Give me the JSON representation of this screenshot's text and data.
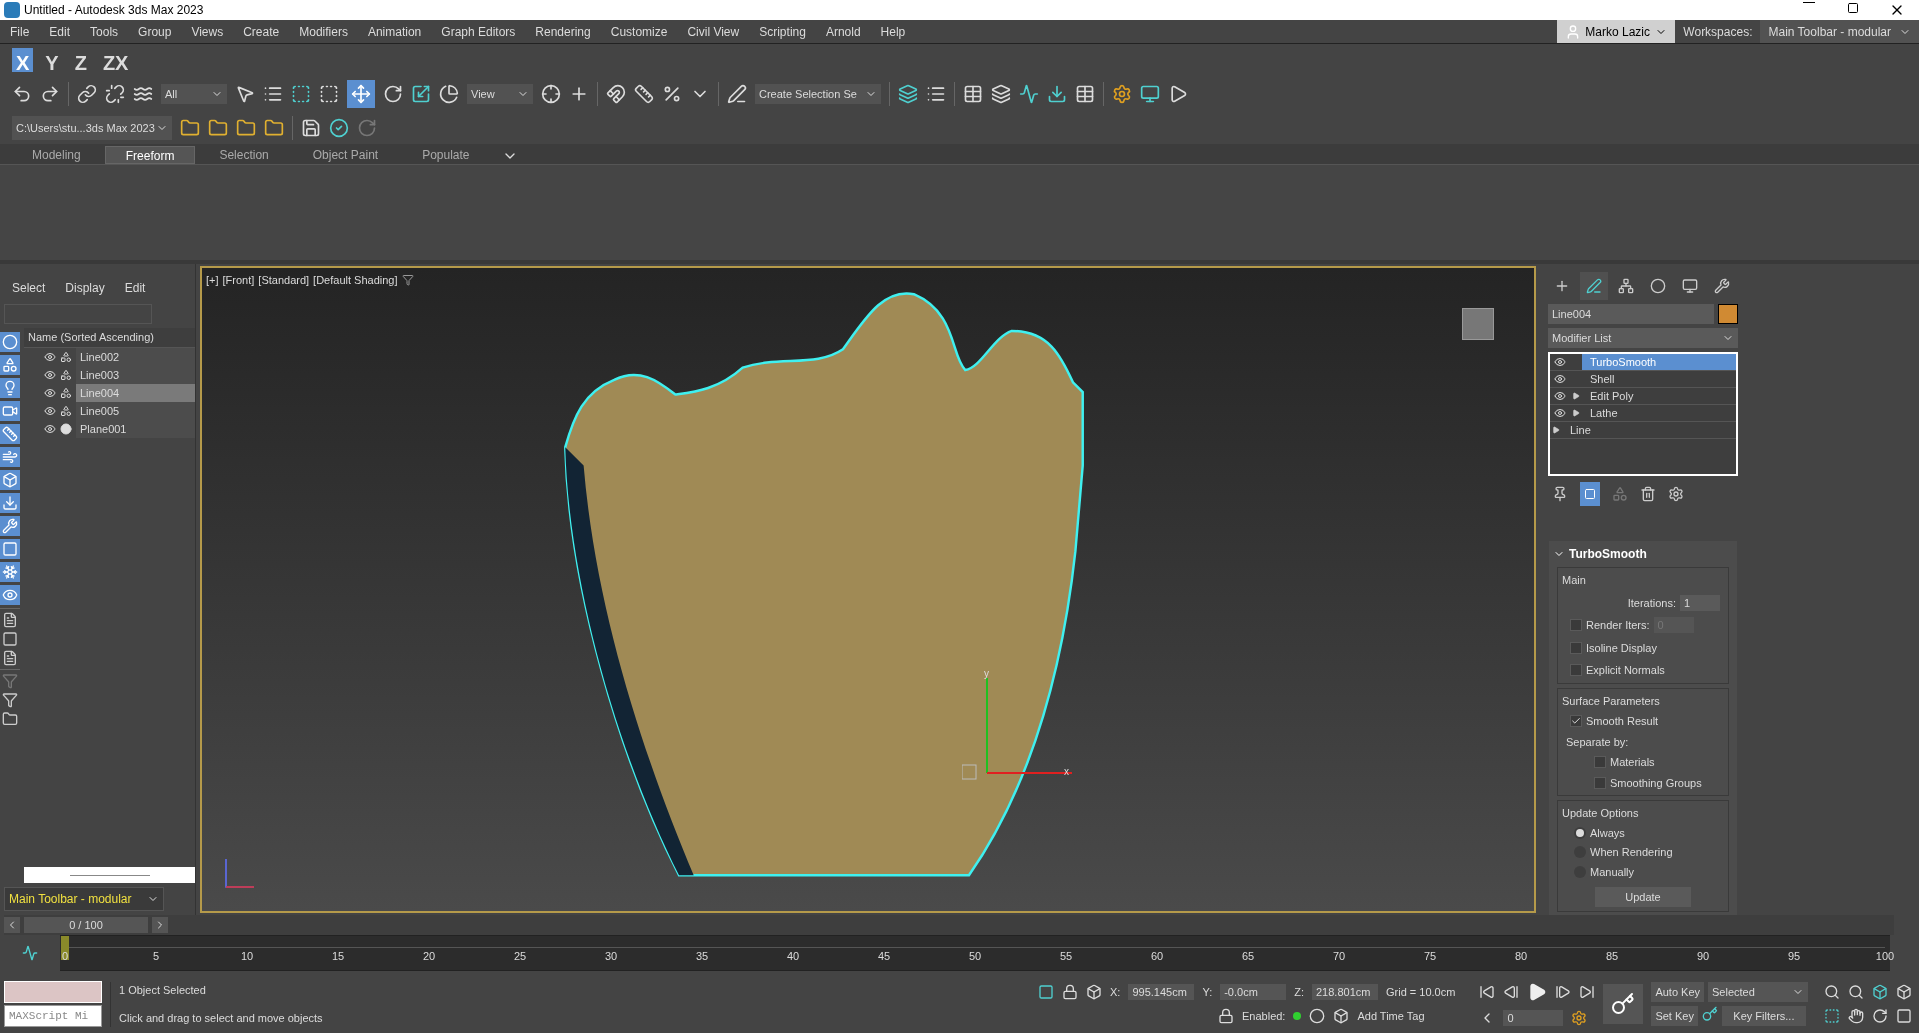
{
  "window": {
    "title": "Untitled - Autodesk 3ds Max 2023"
  },
  "menu": [
    "File",
    "Edit",
    "Tools",
    "Group",
    "Views",
    "Create",
    "Modifiers",
    "Animation",
    "Graph Editors",
    "Rendering",
    "Customize",
    "Civil View",
    "Scripting",
    "Arnold",
    "Help"
  ],
  "user": {
    "name": "Marko Lazic"
  },
  "workspaces": {
    "label": "Workspaces:",
    "value": "Main Toolbar - modular"
  },
  "axis_toolbar": [
    {
      "label": "X",
      "selected": true
    },
    {
      "label": "Y",
      "selected": false
    },
    {
      "label": "Z",
      "selected": false
    },
    {
      "label": "ZX",
      "selected": false
    }
  ],
  "main_toolbar": {
    "selection_filter": "All",
    "reference_coordinate": "View",
    "named_selection": "Create Selection Se"
  },
  "project_path": "C:\\Users\\stu...3ds Max 2023",
  "ribbon_tabs": [
    {
      "label": "Modeling",
      "selected": false
    },
    {
      "label": "Freeform",
      "selected": true
    },
    {
      "label": "Selection",
      "selected": false
    },
    {
      "label": "Object Paint",
      "selected": false
    },
    {
      "label": "Populate",
      "selected": false
    }
  ],
  "scene_explorer": {
    "menu": [
      "Select",
      "Display",
      "Edit"
    ],
    "column": "Name (Sorted Ascending)",
    "items": [
      {
        "name": "Line002",
        "kind": "shape",
        "selected": false
      },
      {
        "name": "Line003",
        "kind": "shape",
        "selected": false
      },
      {
        "name": "Line004",
        "kind": "shape",
        "selected": true
      },
      {
        "name": "Line005",
        "kind": "shape",
        "selected": false
      },
      {
        "name": "Plane001",
        "kind": "geometry",
        "selected": false
      }
    ]
  },
  "workspace_selector": "Main Toolbar - modular",
  "viewport": {
    "labels": [
      "[+]",
      "[Front]",
      "[Standard]",
      "[Default Shading]"
    ],
    "gizmo": {
      "x": "x",
      "y": "y"
    }
  },
  "command_panel": {
    "tabs": [
      {
        "selected": false
      },
      {
        "selected": true
      },
      {
        "selected": false
      },
      {
        "selected": false
      },
      {
        "selected": false
      },
      {
        "selected": false
      }
    ],
    "object_name": "Line004",
    "modifier_list": "Modifier List",
    "stack": [
      {
        "name": "TurboSmooth",
        "kind": "modifier",
        "expandable": false,
        "selected": true
      },
      {
        "name": "Shell",
        "kind": "modifier",
        "expandable": false,
        "selected": false
      },
      {
        "name": "Edit Poly",
        "kind": "modifier",
        "expandable": true,
        "selected": false
      },
      {
        "name": "Lathe",
        "kind": "modifier",
        "expandable": true,
        "selected": false
      },
      {
        "name": "Line",
        "kind": "base",
        "expandable": true,
        "selected": false
      }
    ],
    "rollout": {
      "title": "TurboSmooth",
      "main": {
        "title": "Main",
        "iterations_label": "Iterations:",
        "iterations": "1",
        "render_iters": {
          "label": "Render Iters:",
          "value": "0",
          "checked": false
        },
        "options": [
          {
            "label": "Isoline Display",
            "checked": false
          },
          {
            "label": "Explicit Normals",
            "checked": false
          }
        ]
      },
      "surface": {
        "title": "Surface Parameters",
        "smooth_result": {
          "label": "Smooth Result",
          "checked": true
        },
        "separate_label": "Separate by:",
        "separate": [
          {
            "label": "Materials",
            "checked": false
          },
          {
            "label": "Smoothing Groups",
            "checked": false
          }
        ]
      },
      "update": {
        "title": "Update Options",
        "options": [
          {
            "label": "Always",
            "selected": true
          },
          {
            "label": "When Rendering",
            "selected": false
          },
          {
            "label": "Manually",
            "selected": false
          }
        ],
        "button": "Update"
      }
    }
  },
  "timeline": {
    "slider": {
      "label": "0 / 100"
    },
    "ticks": [
      "0",
      "5",
      "10",
      "15",
      "20",
      "25",
      "30",
      "35",
      "40",
      "45",
      "50",
      "55",
      "60",
      "65",
      "70",
      "75",
      "80",
      "85",
      "90",
      "95",
      "100"
    ]
  },
  "status": {
    "maxscript_placeholder": "MAXScript Mi",
    "selection": "1 Object Selected",
    "prompt": "Click and drag to select and move objects",
    "x_label": "X:",
    "x": "995.145cm",
    "y_label": "Y:",
    "y": "-0.0cm",
    "z_label": "Z:",
    "z": "218.801cm",
    "grid": "Grid = 10.0cm",
    "enabled_label": "Enabled:",
    "add_time_tag": "Add Time Tag",
    "frame": "0",
    "auto_key": "Auto Key",
    "key_mode": "Selected",
    "set_key": "Set Key",
    "key_filters": "Key Filters..."
  }
}
